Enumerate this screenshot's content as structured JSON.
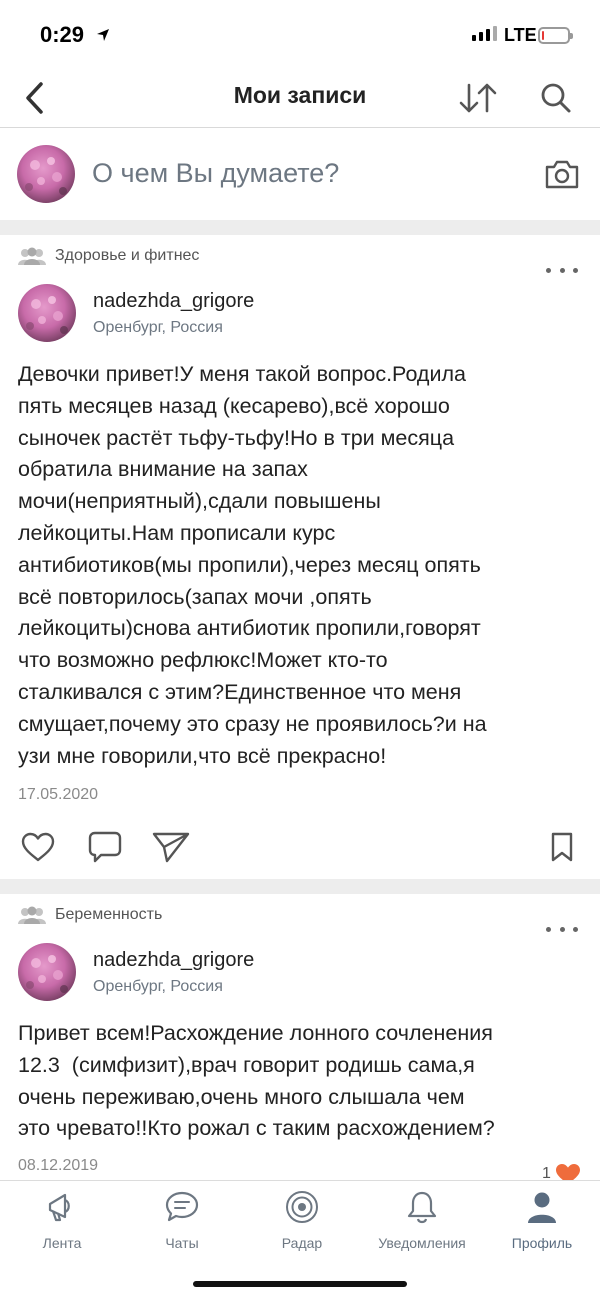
{
  "status_bar": {
    "time": "0:29",
    "network": "LTE",
    "battery_level": 0.05
  },
  "nav": {
    "title": "Мои записи"
  },
  "composer": {
    "placeholder": "О чем Вы думаете?"
  },
  "posts": [
    {
      "community": "Здоровье и фитнес",
      "author": "nadezhda_grigore",
      "location": "Оренбург, Россия",
      "text_lines": [
        "Девочки привет!У меня такой вопрос.Родила",
        "пять месяцев назад (кесарево),всё хорошо",
        "сыночек растёт тьфу-тьфу!Но в три месяца",
        "обратила внимание на запах",
        "мочи(неприятный),сдали повышены",
        "лейкоциты.Нам прописали курс",
        "антибиотиков(мы пропили),через месяц опять",
        "всё повторилось(запах мочи ,опять",
        "лейкоциты)снова антибиотик пропили,говорят",
        "что возможно рефлюкс!Может кто-то",
        "сталкивался с этим?Единственное что меня",
        "смущает,почему это сразу не проявилось?и на",
        "узи мне говорили,что всё прекрасно!"
      ],
      "date": "17.05.2020"
    },
    {
      "community": "Беременность",
      "author": "nadezhda_grigore",
      "location": "Оренбург, Россия",
      "text_lines": [
        "Привет всем!Расхождение лонного сочленения",
        "12.3  (симфизит),врач говорит родишь сама,я",
        "очень переживаю,очень много слышала чем",
        "это чревато!!Кто рожал с таким расхождением?"
      ],
      "date": "08.12.2019",
      "likes": "1"
    }
  ],
  "tabs": [
    {
      "label": "Лента",
      "icon": "megaphone-icon"
    },
    {
      "label": "Чаты",
      "icon": "chat-bubble-icon"
    },
    {
      "label": "Радар",
      "icon": "radar-icon"
    },
    {
      "label": "Уведомления",
      "icon": "bell-icon"
    },
    {
      "label": "Профиль",
      "icon": "person-icon",
      "active": true
    }
  ],
  "colors": {
    "text": "#222222",
    "muted": "#6d7782",
    "divider": "#ededed",
    "like_heart": "#ef6c3c",
    "battery_low": "#e53935"
  }
}
